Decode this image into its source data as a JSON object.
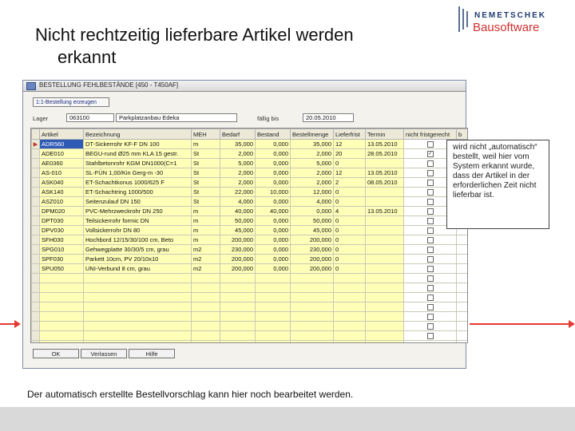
{
  "slide": {
    "title_line1": "Nicht rechtzeitig lieferbare Artikel werden",
    "title_line2": "erkannt",
    "caption": "Der automatisch erstellte Bestellvorschlag kann hier noch bearbeitet werden.",
    "callout": "wird nicht „automatisch“ bestellt, weil hier vom System erkannt wurde, dass der Artikel in der erforderlichen Zeit nicht lieferbar ist.",
    "accent_color": "#e53a33"
  },
  "logo": {
    "line1": "NEMETSCHEK",
    "line2": "Bausoftware"
  },
  "window": {
    "title": "BESTELLUNG FEHLBESTÄNDE [450 - T450AF]",
    "generate_button": "1:1-Bestellung erzeugen",
    "lager_label": "Lager",
    "lager_value": "063100",
    "project_value": "Parkplatzanbau Edeka",
    "date_label": "fällig bis",
    "date_value": "20.05.2010",
    "buttons": {
      "ok": "OK",
      "cancel": "Verlassen",
      "help": "Hilfe"
    }
  },
  "grid": {
    "columns": [
      "Artikel",
      "Bezeichnung",
      "MEH",
      "Bedarf",
      "Bestand",
      "Bestellmenge",
      "Lieferfrist",
      "Termin",
      "nicht fristgerecht",
      "b"
    ],
    "rows": [
      {
        "artikel": "ADR560",
        "bez": "DT-Sickerrohr KF-F DN 100",
        "meh": "m",
        "bedarf": "35,000",
        "bestand": "0,000",
        "menge": "35,000",
        "frist": "12",
        "termin": "13.05.2010",
        "late": false
      },
      {
        "artikel": "ADE010",
        "bez": "BEGU-rund Ø25 mm KLA 15 gestr.",
        "meh": "St",
        "bedarf": "2,000",
        "bestand": "0,000",
        "menge": "2,000",
        "frist": "20",
        "termin": "28.05.2010",
        "late": true
      },
      {
        "artikel": "AE0360",
        "bez": "Stahlbetonrohr KGM DN1000(C=1",
        "meh": "St",
        "bedarf": "5,000",
        "bestand": "0,000",
        "menge": "5,000",
        "frist": "0",
        "termin": "",
        "late": false
      },
      {
        "artikel": "AS-010",
        "bez": "SL-FÜN 1,00/Kin Gerg-m -30",
        "meh": "St",
        "bedarf": "2,000",
        "bestand": "0,000",
        "menge": "2,000",
        "frist": "12",
        "termin": "13.05.2010",
        "late": false
      },
      {
        "artikel": "ASK040",
        "bez": "ET-Schachtkonus 1000/625 F",
        "meh": "St",
        "bedarf": "2,000",
        "bestand": "0,000",
        "menge": "2,000",
        "frist": "2",
        "termin": "08.05.2010",
        "late": false
      },
      {
        "artikel": "ASK140",
        "bez": "ET-Schachtring 1000/500",
        "meh": "St",
        "bedarf": "22,000",
        "bestand": "10,000",
        "menge": "12,000",
        "frist": "0",
        "termin": "",
        "late": false
      },
      {
        "artikel": "ASZ010",
        "bez": "Seitenzulauf DN 150",
        "meh": "St",
        "bedarf": "4,000",
        "bestand": "0,000",
        "menge": "4,000",
        "frist": "0",
        "termin": "",
        "late": false
      },
      {
        "artikel": "DPM020",
        "bez": "PVC-Mehrzweckrohr DN 250",
        "meh": "m",
        "bedarf": "40,000",
        "bestand": "40,000",
        "menge": "0,000",
        "frist": "4",
        "termin": "13.05.2010",
        "late": false
      },
      {
        "artikel": "DPT030",
        "bez": "Teilsickerrohr formic DN",
        "meh": "m",
        "bedarf": "50,000",
        "bestand": "0,000",
        "menge": "50,000",
        "frist": "0",
        "termin": "",
        "late": false
      },
      {
        "artikel": "DPV030",
        "bez": "Vollsickerrohr DN 80",
        "meh": "m",
        "bedarf": "45,000",
        "bestand": "0,000",
        "menge": "45,000",
        "frist": "0",
        "termin": "",
        "late": false
      },
      {
        "artikel": "SFH030",
        "bez": "Hochbord 12/15/30/100 cm, Beto",
        "meh": "m",
        "bedarf": "200,000",
        "bestand": "0,000",
        "menge": "200,000",
        "frist": "0",
        "termin": "",
        "late": false
      },
      {
        "artikel": "SPG010",
        "bez": "Gehwegplatte 30/30/5 cm, grau",
        "meh": "m2",
        "bedarf": "230,000",
        "bestand": "0,000",
        "menge": "230,000",
        "frist": "0",
        "termin": "",
        "late": false
      },
      {
        "artikel": "SPF030",
        "bez": "Parkett 10cm, PV 20/10x10",
        "meh": "m2",
        "bedarf": "200,000",
        "bestand": "0,000",
        "menge": "200,000",
        "frist": "0",
        "termin": "",
        "late": false
      },
      {
        "artikel": "SPU050",
        "bez": "UNI-Verbund 8 cm, grau",
        "meh": "m2",
        "bedarf": "200,000",
        "bestand": "0,000",
        "menge": "200,000",
        "frist": "0",
        "termin": "",
        "late": false
      }
    ]
  }
}
